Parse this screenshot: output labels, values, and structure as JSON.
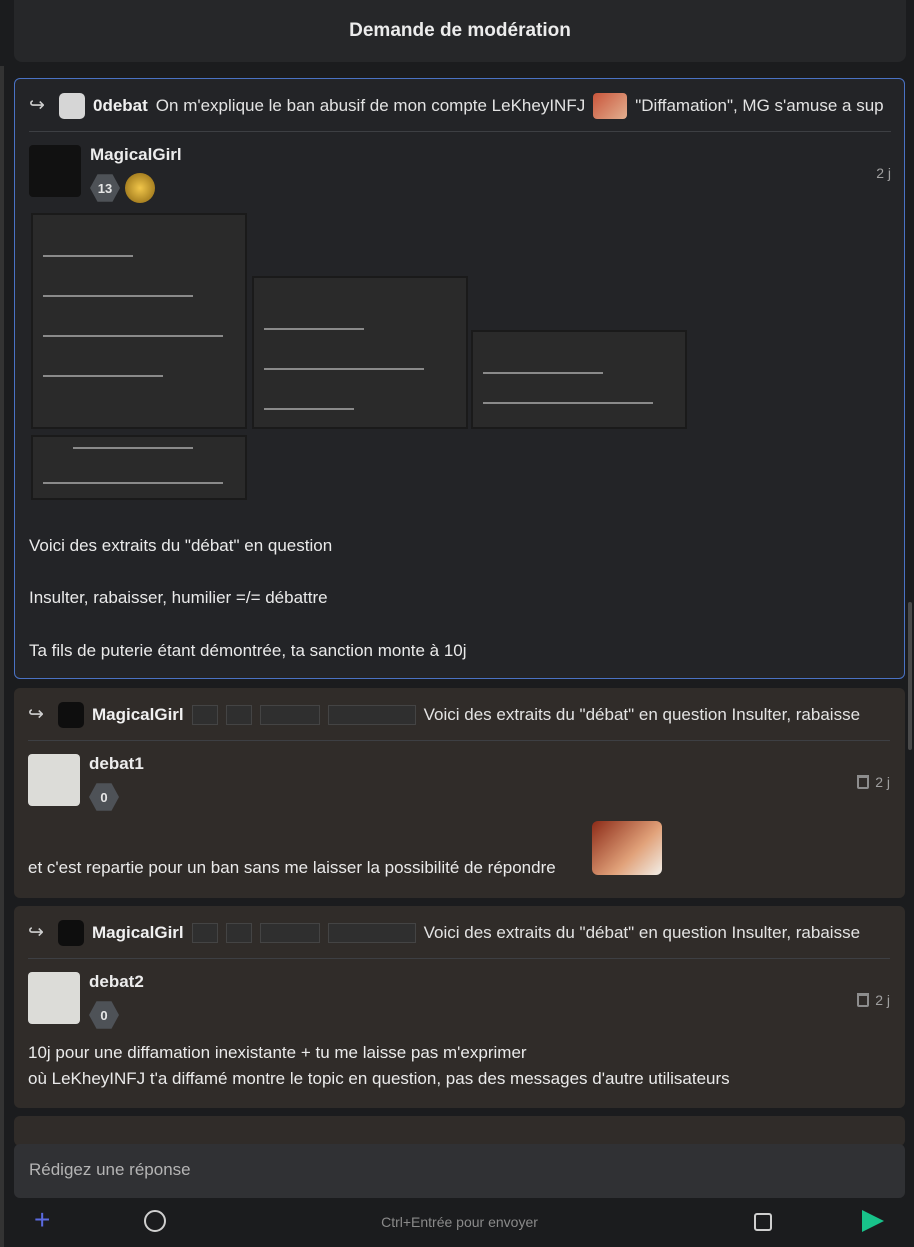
{
  "header": {
    "title": "Demande de modération"
  },
  "posts": [
    {
      "quote": {
        "name": "0debat",
        "text": "On m'explique le ban abusif de mon compte LeKheyINFJ",
        "text2": "\"Diffamation\", MG s'amuse a sup"
      },
      "author": {
        "name": "MagicalGirl",
        "badge": "13",
        "time": "2 j"
      },
      "lines": [
        "Voici des extraits du \"débat\" en question",
        "Insulter, rabaisser, humilier =/= débattre",
        "Ta fils de puterie étant démontrée, ta sanction monte à 10j"
      ]
    },
    {
      "quote": {
        "name": "MagicalGirl",
        "text": "Voici des extraits du \"débat\" en question  Insulter, rabaisse"
      },
      "author": {
        "name": "debat1",
        "badge": "0",
        "time": "2 j"
      },
      "lines": [
        "et c'est repartie pour un ban sans me laisser la possibilité de répondre"
      ]
    },
    {
      "quote": {
        "name": "MagicalGirl",
        "text": "Voici des extraits du \"débat\" en question  Insulter, rabaisse"
      },
      "author": {
        "name": "debat2",
        "badge": "0",
        "time": "2 j"
      },
      "lines": [
        "10j pour une diffamation inexistante + tu me laisse pas m'exprimer",
        "où LeKheyINFJ t'a diffamé montre le topic en question, pas des messages d'autre utilisateurs"
      ]
    }
  ],
  "composer": {
    "placeholder": "Rédigez une réponse",
    "hint": "Ctrl+Entrée pour envoyer"
  },
  "colors": {
    "accent_border": "#4a72c4",
    "send": "#18c28a",
    "plus": "#5b6ae0"
  }
}
